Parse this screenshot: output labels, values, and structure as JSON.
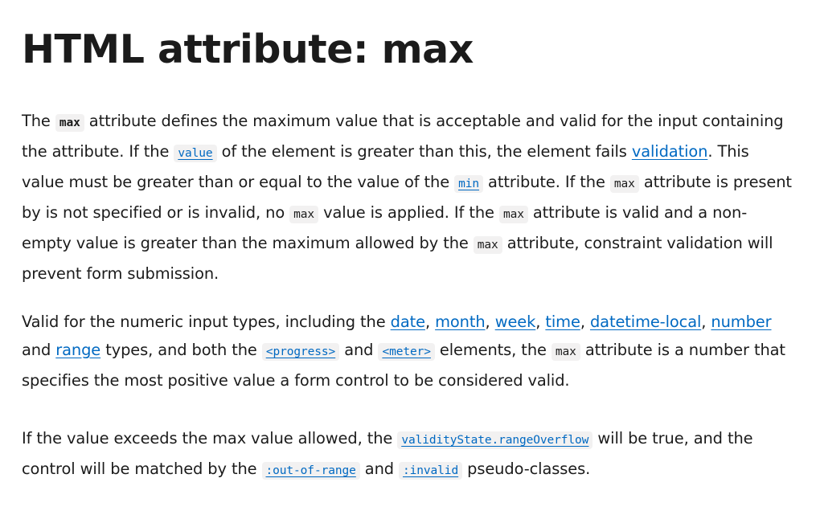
{
  "title": "HTML attribute: max",
  "p1": {
    "t1": "The ",
    "c1": "max",
    "t2": " attribute defines the maximum value that is acceptable and valid for the input containing the attribute. If the ",
    "l1": "value",
    "t3": " of the element is greater than this, the element fails ",
    "l2": "validation",
    "t4": ". This value must be greater than or equal to the value of the ",
    "l3": "min",
    "t5": " attribute. If the ",
    "c2": "max",
    "t6": " attribute is present by is not specified or is invalid, no ",
    "c3": "max",
    "t7": " value is applied. If the ",
    "c4": "max",
    "t8": " attribute is valid and a non-empty value is greater than the maximum allowed by the ",
    "c5": "max",
    "t9": " attribute, constraint validation will prevent form submission."
  },
  "p2": {
    "t1": "Valid for the numeric input types, including the ",
    "l1": "date",
    "s1": ", ",
    "l2": "month",
    "s2": ", ",
    "l3": "week",
    "s3": ", ",
    "l4": "time",
    "s4": ", ",
    "l5": "datetime-local",
    "s5": ", ",
    "l6": "number",
    "t2": " and ",
    "l7": "range",
    "t3": " types, and both the ",
    "l8": "<progress>",
    "t4": " and ",
    "l9": "<meter>",
    "t5": " elements, the ",
    "c1": "max",
    "t6": " attribute is a number that specifies the most positive value a form control to be considered valid."
  },
  "p3": {
    "t1": "If the value exceeds the max value allowed, the ",
    "l1": "validityState.rangeOverflow",
    "t2": " will be true, and the control will be matched by the ",
    "l2": ":out-of-range",
    "t3": " and ",
    "l3": ":invalid",
    "t4": " pseudo-classes."
  }
}
